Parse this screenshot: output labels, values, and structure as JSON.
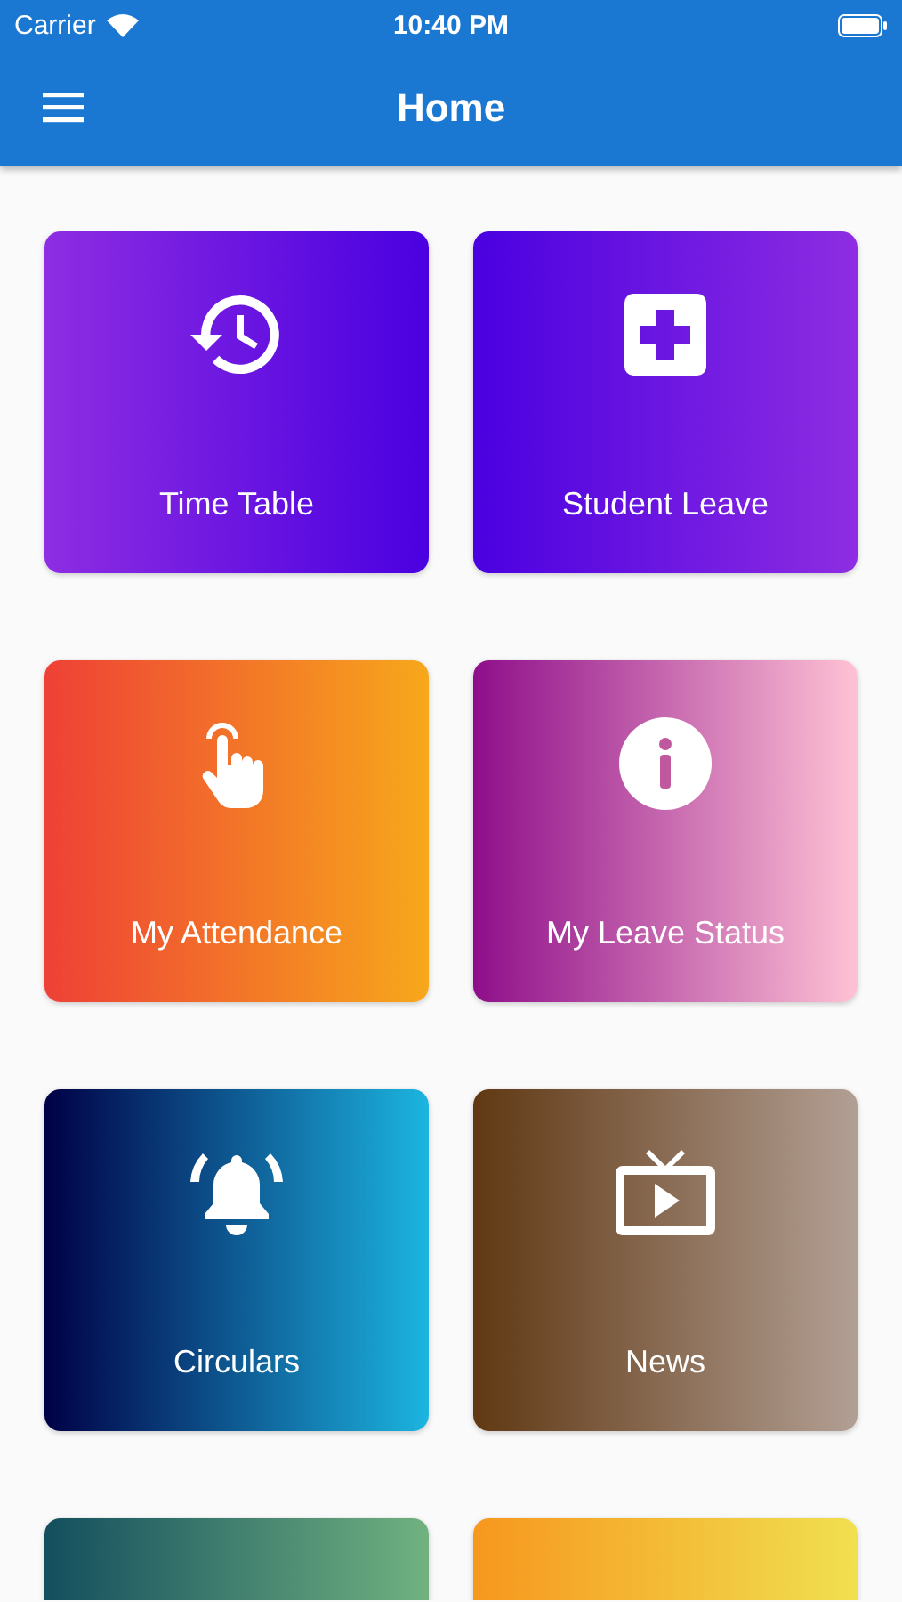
{
  "status_bar": {
    "carrier": "Carrier",
    "time": "10:40 PM"
  },
  "app_bar": {
    "title": "Home"
  },
  "tiles": [
    {
      "label": "Time Table",
      "stops": [
        {
          "color": "#8e2de2"
        },
        {
          "color": "#4a00e0"
        }
      ]
    },
    {
      "label": "Student Leave",
      "stops": [
        {
          "color": "#4a00e0"
        },
        {
          "color": "#8e2de2"
        }
      ]
    },
    {
      "label": "My Attendance",
      "stops": [
        {
          "color": "#ee4036"
        },
        {
          "color": "#f7a81b"
        }
      ]
    },
    {
      "label": "My Leave Status",
      "stops": [
        {
          "color": "#8e0e8a"
        },
        {
          "color": "#ffc2d4"
        }
      ]
    },
    {
      "label": "Circulars",
      "stops": [
        {
          "color": "#000046"
        },
        {
          "color": "#1cb5e0"
        }
      ]
    },
    {
      "label": "News",
      "stops": [
        {
          "color": "#603813"
        },
        {
          "color": "#b29f94"
        }
      ]
    },
    {
      "stops": [
        {
          "color": "#134e5e"
        },
        {
          "color": "#71b280"
        }
      ]
    },
    {
      "stops": [
        {
          "color": "#f7971e"
        },
        {
          "color": "#f0e050"
        }
      ]
    }
  ]
}
